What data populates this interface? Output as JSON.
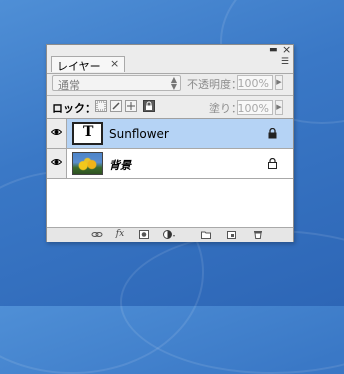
{
  "panel": {
    "tab_label": "レイヤー",
    "tab_close": "×",
    "window_controls": {
      "minimize": "▬",
      "close": "×"
    },
    "menu_icon": "☰"
  },
  "blend": {
    "mode": "通常",
    "opacity_label": "不透明度：",
    "opacity_value": "100%"
  },
  "lock": {
    "label": "ロック：",
    "fill_label": "塗り：",
    "fill_value": "100%"
  },
  "layers": [
    {
      "name": "Sunflower",
      "type": "text",
      "thumb_glyph": "T",
      "selected": true,
      "visible": true,
      "locked": true
    },
    {
      "name": "背景",
      "type": "image",
      "selected": false,
      "visible": true,
      "locked": true
    }
  ],
  "bottom_icons": [
    "link-layers-icon",
    "fx-icon",
    "mask-icon",
    "adjustment-icon",
    "group-folder-icon",
    "new-layer-icon",
    "trash-icon"
  ],
  "bottom_fx": "fx",
  "colors": {
    "desktop": "#3a78c6",
    "selection": "#b5d3f5",
    "panel": "#ececec"
  }
}
